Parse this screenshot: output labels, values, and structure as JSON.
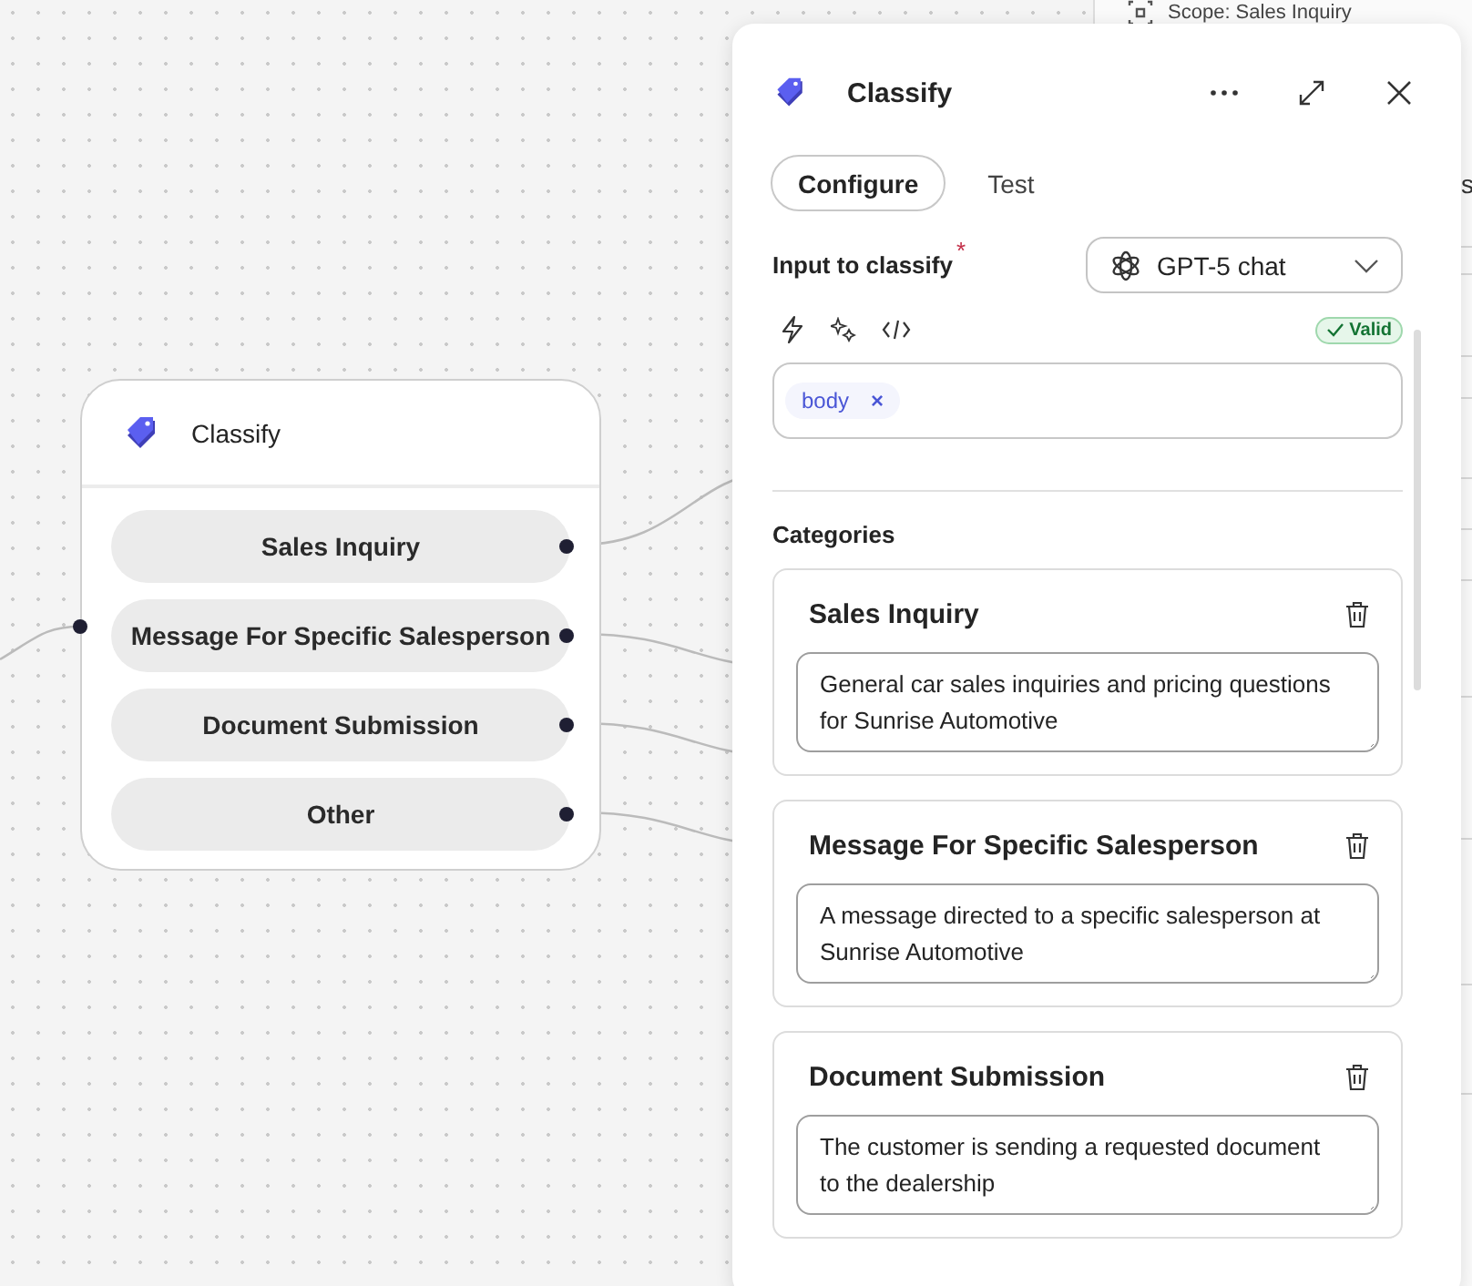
{
  "background": {
    "scope_label": "Scope: Sales Inquiry",
    "column_fragment": "s"
  },
  "node": {
    "title": "Classify",
    "outputs": [
      {
        "label": "Sales Inquiry"
      },
      {
        "label": "Message For Specific Salesperson"
      },
      {
        "label": "Document Submission"
      },
      {
        "label": "Other"
      }
    ]
  },
  "panel": {
    "title": "Classify",
    "tabs": [
      {
        "label": "Configure",
        "selected": true
      },
      {
        "label": "Test",
        "selected": false
      }
    ],
    "input": {
      "label": "Input to classify",
      "required_mark": "*",
      "model": "GPT-5 chat",
      "status": "Valid",
      "tokens": [
        {
          "label": "body",
          "remove": "×"
        }
      ]
    },
    "categories_heading": "Categories",
    "categories": [
      {
        "name": "Sales Inquiry",
        "description": "General car sales inquiries and pricing questions for Sunrise Automotive"
      },
      {
        "name": "Message For Specific Salesperson",
        "description": "A message directed to a specific salesperson at Sunrise Automotive"
      },
      {
        "name": "Document Submission",
        "description": "The customer is sending a requested document to the dealership"
      }
    ]
  }
}
